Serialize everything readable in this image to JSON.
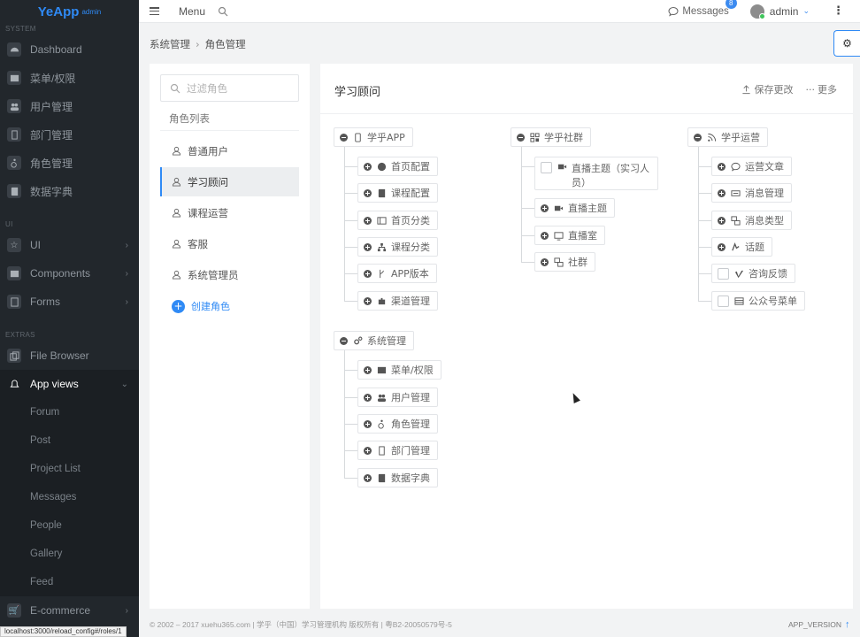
{
  "brand": {
    "logo": "YeApp",
    "sub": "admin"
  },
  "sidebar": {
    "sections": [
      {
        "label": "SYSTEM"
      },
      {
        "label": "UI"
      },
      {
        "label": "EXTRAS"
      }
    ],
    "system_items": [
      {
        "label": "Dashboard",
        "icon": "dashboard-icon"
      },
      {
        "label": "菜单/权限",
        "icon": "table-icon"
      },
      {
        "label": "用户管理",
        "icon": "users-icon"
      },
      {
        "label": "部门管理",
        "icon": "building-icon"
      },
      {
        "label": "角色管理",
        "icon": "wheelchair-icon"
      },
      {
        "label": "数据字典",
        "icon": "book-icon"
      }
    ],
    "ui_items": [
      {
        "label": "UI",
        "icon": "star-icon"
      },
      {
        "label": "Components",
        "icon": "grid-icon"
      },
      {
        "label": "Forms",
        "icon": "form-icon"
      }
    ],
    "extras_items": [
      {
        "label": "File Browser",
        "icon": "files-icon"
      },
      {
        "label": "App views",
        "icon": "bell-icon"
      }
    ],
    "app_views_sub": [
      "Forum",
      "Post",
      "Project List",
      "Messages",
      "People",
      "Gallery",
      "Feed"
    ],
    "last_item": "E-commerce"
  },
  "topbar": {
    "menu_label": "Menu",
    "messages_label": "Messages",
    "messages_count": "8",
    "user_name": "admin"
  },
  "breadcrumb": {
    "parent": "系统管理",
    "current": "角色管理"
  },
  "roles": {
    "search_placeholder": "过滤角色",
    "list_title": "角色列表",
    "items": [
      "普通用户",
      "学习顾问",
      "课程运营",
      "客服",
      "系统管理员"
    ],
    "active_index": 1,
    "create_label": "创建角色"
  },
  "main": {
    "title": "学习顾问",
    "save_label": "保存更改",
    "more_label": "更多"
  },
  "tree": {
    "app": {
      "label": "学乎APP",
      "children": [
        "首页配置",
        "课程配置",
        "首页分类",
        "课程分类",
        "APP版本",
        "渠道管理"
      ]
    },
    "community": {
      "label": "学乎社群",
      "children": [
        "直播主题（实习人员）",
        "直播主题",
        "直播室",
        "社群"
      ]
    },
    "ops": {
      "label": "学乎运营",
      "children": [
        "运营文章",
        "消息管理",
        "消息类型",
        "话题",
        "咨询反馈",
        "公众号菜单"
      ]
    },
    "system": {
      "label": "系统管理",
      "children": [
        "菜单/权限",
        "用户管理",
        "角色管理",
        "部门管理",
        "数据字典"
      ]
    }
  },
  "footer": {
    "copyright": "© 2002 – 2017 xuehu365.com | 学乎（中国）学习管理机构 版权所有 | 粤B2-20050579号-5",
    "version": "APP_VERSION"
  },
  "statusbar": "localhost:3000/reload_config#/roles/1",
  "colors": {
    "accent": "#2f8af5",
    "sidebar_bg": "#22272c"
  }
}
